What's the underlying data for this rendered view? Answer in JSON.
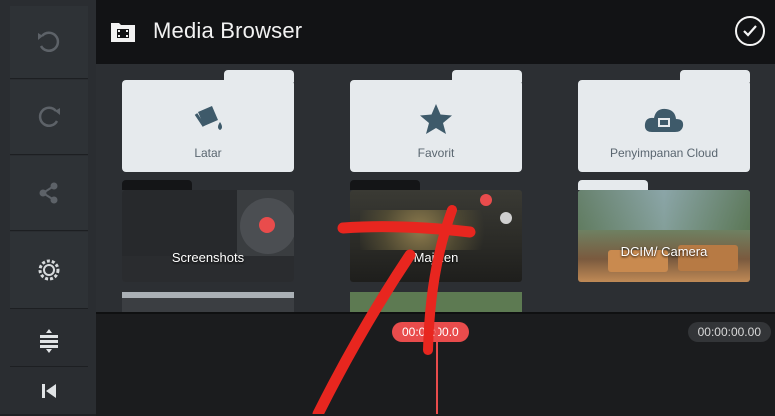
{
  "header": {
    "title": "Media Browser",
    "title_icon": "film-folder-icon",
    "done_icon": "check-circle-icon"
  },
  "rail": {
    "items": [
      {
        "icon": "undo-icon"
      },
      {
        "icon": "redo-icon"
      },
      {
        "icon": "share-icon"
      },
      {
        "icon": "settings-icon"
      },
      {
        "icon": "layers-adjust-icon"
      },
      {
        "icon": "skip-to-start-icon"
      }
    ]
  },
  "folders": [
    {
      "label": "Latar",
      "icon": "paint-bucket-icon"
    },
    {
      "label": "Favorit",
      "icon": "star-icon"
    },
    {
      "label": "Penyimpanan Cloud",
      "icon": "cloud-film-icon"
    }
  ],
  "albums": [
    {
      "label": "Screenshots"
    },
    {
      "label": "Majizen"
    },
    {
      "label": "DCIM/ Camera"
    }
  ],
  "timeline": {
    "current_time": "00:00:00.0",
    "total_time": "00:00:00.00"
  },
  "colors": {
    "accent_red": "#e94c4c",
    "folder_bg": "#e6eaed",
    "header_bg": "#121315"
  }
}
